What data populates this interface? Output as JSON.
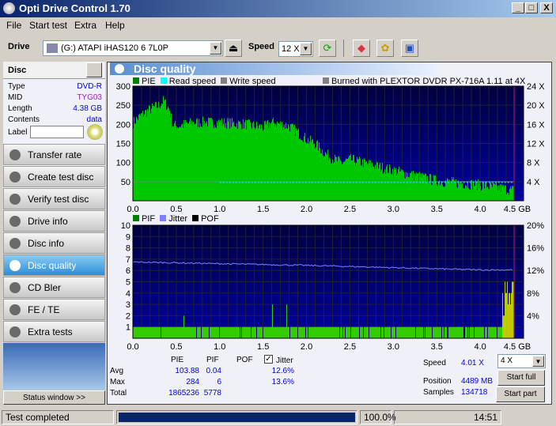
{
  "window": {
    "title": "Opti Drive Control 1.70",
    "min": "_",
    "max": "□",
    "close": "X"
  },
  "menu": [
    "File",
    "Start test",
    "Extra",
    "Help"
  ],
  "toolbar": {
    "drive_label": "Drive",
    "drive_value": "(G:)   ATAPI iHAS120   6 7L0P",
    "speed_label": "Speed",
    "speed_value": "12 X"
  },
  "disc": {
    "header": "Disc",
    "rows": [
      {
        "k": "Type",
        "v": "DVD-R"
      },
      {
        "k": "MID",
        "v": "TYG03"
      },
      {
        "k": "Length",
        "v": "4.38 GB"
      },
      {
        "k": "Contents",
        "v": "data"
      }
    ],
    "label_label": "Label",
    "label_value": ""
  },
  "nav": [
    {
      "label": "Transfer rate"
    },
    {
      "label": "Create test disc"
    },
    {
      "label": "Verify test disc"
    },
    {
      "label": "Drive info"
    },
    {
      "label": "Disc info"
    },
    {
      "label": "Disc quality",
      "active": true
    },
    {
      "label": "CD Bler"
    },
    {
      "label": "FE / TE"
    },
    {
      "label": "Extra tests"
    }
  ],
  "status_window": "Status window >>",
  "panel": {
    "title": "Disc quality"
  },
  "chart_data": [
    {
      "type": "bar",
      "legend": [
        "PIE",
        "Read speed",
        "Write speed"
      ],
      "annotation": "Burned with PLEXTOR DVDR   PX-716A 1.11 at 4X",
      "xlabel": "GB",
      "xlim": [
        0,
        4.5
      ],
      "ylim": [
        0,
        300
      ],
      "y2lim": [
        0,
        24
      ],
      "xticks": [
        "0.0",
        "0.5",
        "1.0",
        "1.5",
        "2.0",
        "2.5",
        "3.0",
        "3.5",
        "4.0",
        "4.5 GB"
      ],
      "yticks": [
        "50",
        "100",
        "150",
        "200",
        "250",
        "300"
      ],
      "y2ticks": [
        "4 X",
        "8 X",
        "12 X",
        "16 X",
        "20 X",
        "24 X"
      ],
      "pie_profile": {
        "x": [
          0,
          0.1,
          0.2,
          0.3,
          0.35,
          0.42,
          0.45,
          0.5,
          0.7,
          1.0,
          1.3,
          1.5,
          1.6,
          1.8,
          1.9,
          2.0,
          2.1,
          2.2,
          2.3,
          2.4,
          2.5,
          3.0,
          3.5,
          4.0,
          4.39
        ],
        "y": [
          205,
          225,
          240,
          250,
          262,
          238,
          200,
          195,
          205,
          205,
          200,
          192,
          205,
          195,
          178,
          160,
          150,
          125,
          110,
          100,
          108,
          79,
          52,
          41,
          27
        ]
      },
      "read_speed_x": 4.0,
      "write_speed_x": 4.0,
      "end_gb": 4.39,
      "colors": {
        "pie": "#00c800",
        "read": "#00ffff",
        "write": "#808080"
      }
    },
    {
      "type": "bar",
      "legend": [
        "PIF",
        "Jitter",
        "POF"
      ],
      "xlim": [
        0,
        4.5
      ],
      "ylim": [
        0,
        10
      ],
      "y2lim": [
        0,
        20
      ],
      "xticks": [
        "0.0",
        "0.5",
        "1.0",
        "1.5",
        "2.0",
        "2.5",
        "3.0",
        "3.5",
        "4.0",
        "4.5 GB"
      ],
      "yticks": [
        "1",
        "2",
        "3",
        "4",
        "5",
        "6",
        "7",
        "8",
        "9",
        "10"
      ],
      "y2ticks": [
        "4%",
        "8%",
        "12%",
        "16%",
        "20%"
      ],
      "pif_baseline": 1,
      "pif_max": 6,
      "jitter_profile": {
        "x": [
          0,
          1,
          2,
          3,
          4,
          4.39
        ],
        "y": [
          13.5,
          13.2,
          12.9,
          12.5,
          12.1,
          12.1
        ]
      },
      "colors": {
        "pif": "#33cc00",
        "jitter": "#8080ff",
        "pof": "#000000"
      }
    }
  ],
  "stats": {
    "headers": [
      "PIE",
      "PIF",
      "POF"
    ],
    "jitter_label": "Jitter",
    "jitter_checked": true,
    "rows": [
      {
        "k": "Avg",
        "pie": "103.88",
        "pif": "0.04",
        "jit": "12.6%"
      },
      {
        "k": "Max",
        "pie": "284",
        "pif": "6",
        "jit": "13.6%"
      },
      {
        "k": "Total",
        "pie": "1865236",
        "pif": "5778",
        "jit": ""
      }
    ]
  },
  "right": {
    "speed_label": "Speed",
    "speed": "4.01 X",
    "position_label": "Position",
    "position": "4489 MB",
    "samples_label": "Samples",
    "samples": "134718",
    "speed_select": "4 X",
    "start_full": "Start full",
    "start_part": "Start part"
  },
  "statusbar": {
    "text": "Test completed",
    "progress": 100,
    "percent": "100.0%",
    "time": "14:51"
  }
}
